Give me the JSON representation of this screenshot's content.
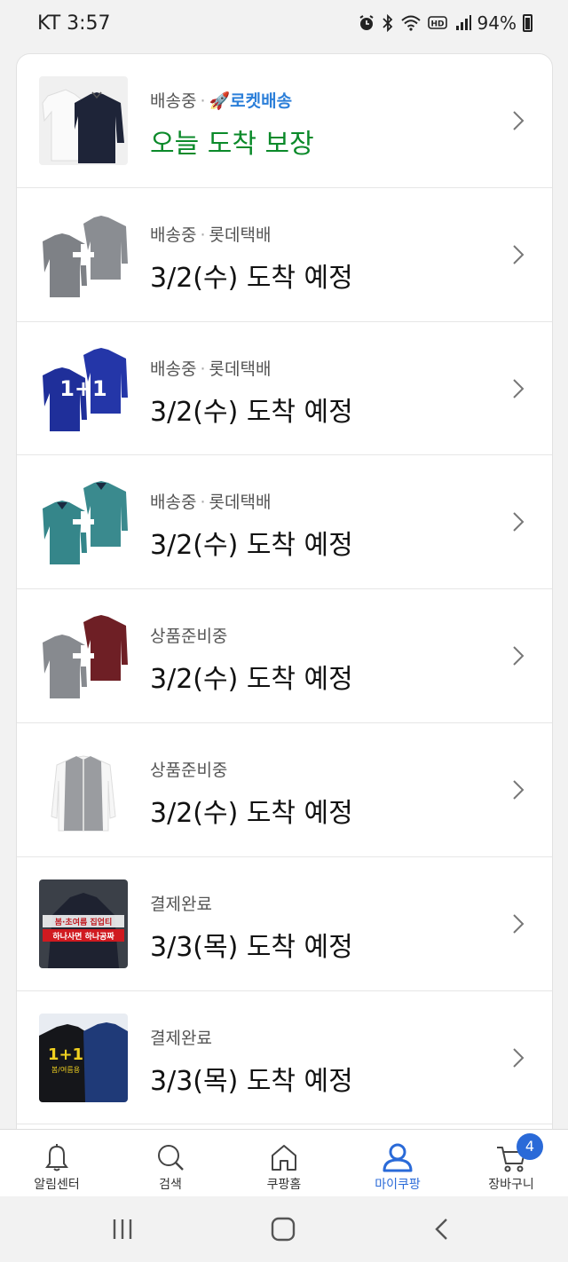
{
  "status": {
    "time": "KT 3:57",
    "battery": "94%",
    "icons": [
      "alarm-icon",
      "bluetooth-icon",
      "wifi-icon",
      "hd-icon",
      "signal-icon",
      "battery-icon"
    ]
  },
  "orders": [
    {
      "status": "배송중",
      "carrier": "로켓배송",
      "eta": "오늘 도착 보장",
      "rocket": true,
      "thumb": "white-and-navy-shirts"
    },
    {
      "status": "배송중",
      "carrier": "롯데택배",
      "eta": "3/2(수) 도착 예정",
      "thumb": "grey-shirts-plus"
    },
    {
      "status": "배송중",
      "carrier": "롯데택배",
      "eta": "3/2(수) 도착 예정",
      "thumb_text": "1+1"
    },
    {
      "status": "배송중",
      "carrier": "롯데택배",
      "eta": "3/2(수) 도착 예정",
      "thumb": "teal-polo-plus"
    },
    {
      "status": "상품준비중",
      "eta": "3/2(수) 도착 예정",
      "thumb": "grey-and-maroon-plus"
    },
    {
      "status": "상품준비중",
      "eta": "3/2(수) 도착 예정",
      "thumb": "grey-vest"
    },
    {
      "status": "결제완료",
      "eta": "3/3(목) 도착 예정",
      "thumb_text_1": "봄·초여름 집업티",
      "thumb_text_2": "하나사면 하나공짜"
    },
    {
      "status": "결제완료",
      "eta": "3/3(목) 도착 예정",
      "thumb_text_1": "1+1",
      "thumb_text_2": "봄/여름용"
    }
  ],
  "tabs": [
    {
      "label": "알림센터",
      "icon": "bell-icon"
    },
    {
      "label": "검색",
      "icon": "search-icon"
    },
    {
      "label": "쿠팡홈",
      "icon": "home-icon"
    },
    {
      "label": "마이쿠팡",
      "icon": "person-icon",
      "active": true
    },
    {
      "label": "장바구니",
      "icon": "cart-icon",
      "badge": "4"
    }
  ],
  "colors": {
    "accent": "#2a6ad8",
    "rocket_green": "#0b8a2a",
    "rocket_blue": "#2c7fd9"
  }
}
